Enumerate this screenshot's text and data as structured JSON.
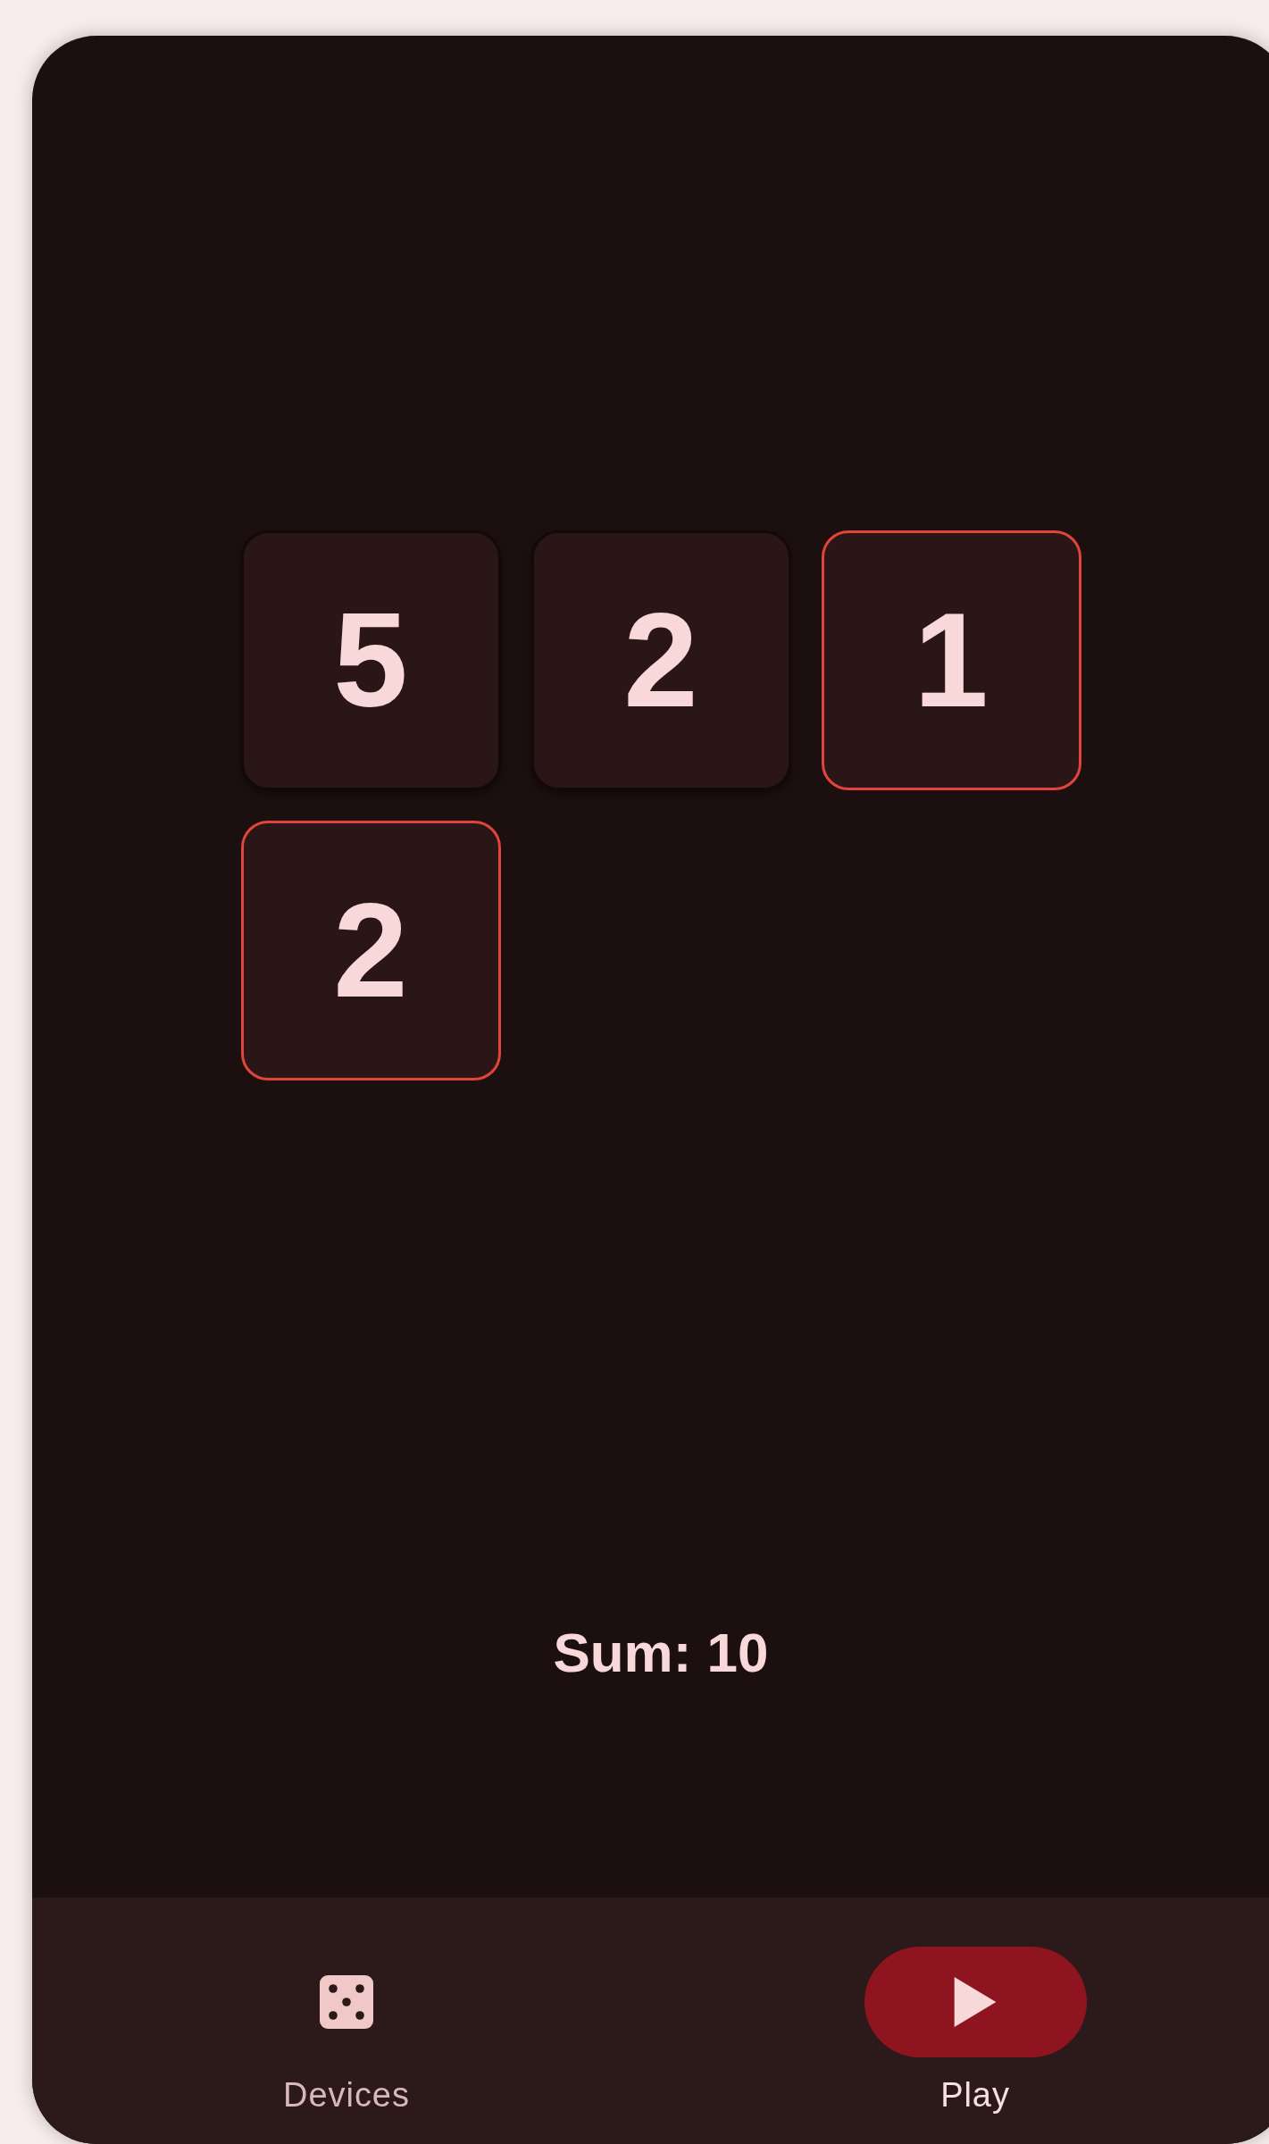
{
  "dice": [
    {
      "value": "5",
      "held": false
    },
    {
      "value": "2",
      "held": false
    },
    {
      "value": "1",
      "held": true
    },
    {
      "value": "2",
      "held": true
    }
  ],
  "sum": "Sum: 10",
  "nav": [
    {
      "label": "Devices",
      "kind": "devices",
      "selected": false
    },
    {
      "label": "Play",
      "kind": "play",
      "selected": true
    }
  ]
}
